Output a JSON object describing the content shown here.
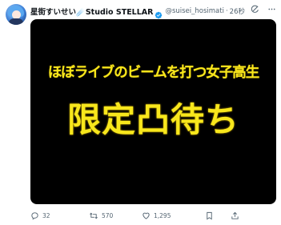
{
  "tweet": {
    "display_name": "星街すいせい☄️Studio STELLAR",
    "handle": "@suisei_hosimati",
    "separator": "·",
    "time": "26秒",
    "verified": true,
    "top_icons": [
      "grok-icon",
      "more-icon"
    ],
    "media": {
      "line1": "ほぼライブのビームを打つ女子高生",
      "line2": "限定凸待ち",
      "text_color": "#f8e71c",
      "background": "#000000"
    },
    "actions": {
      "reply_count": "32",
      "retweet_count": "570",
      "like_count": "1,295"
    }
  },
  "colors": {
    "verified": "#1d9bf0",
    "secondary_text": "#536471"
  }
}
